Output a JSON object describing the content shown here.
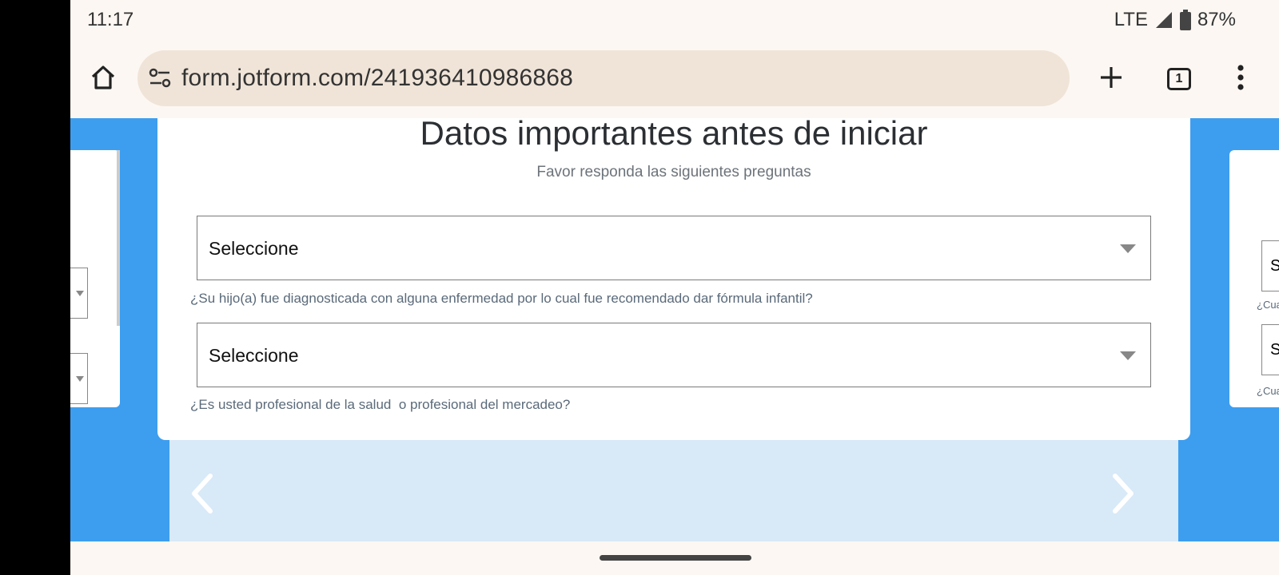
{
  "status": {
    "time": "11:17",
    "network": "LTE",
    "battery": "87%"
  },
  "browser": {
    "url": "form.jotform.com/241936410986868",
    "tab_count": "1"
  },
  "form": {
    "title": "Datos importantes antes de iniciar",
    "subtitle": "Favor responda las siguientes preguntas",
    "questions": [
      {
        "selected": "Seleccione",
        "caption": "¿Su hijo(a) fue diagnosticada con alguna enfermedad por lo cual fue recomendado dar fórmula infantil?"
      },
      {
        "selected": "Seleccione",
        "caption": "¿Es usted profesional de la salud  o profesional del mercadeo?"
      }
    ]
  },
  "right_peek": {
    "box_letter": "S",
    "caption": "¿Cua"
  },
  "colors": {
    "background": "#3d9ef0",
    "card_bottom": "#d8e9f8",
    "browser_chrome": "#fcf7f2",
    "url_pill": "#f0e4d8"
  },
  "icons": [
    "home-icon",
    "tune-icon",
    "plus-icon",
    "tabs-icon",
    "more-vert-icon",
    "chevron-left-icon",
    "chevron-right-icon",
    "signal-icon",
    "battery-icon"
  ]
}
